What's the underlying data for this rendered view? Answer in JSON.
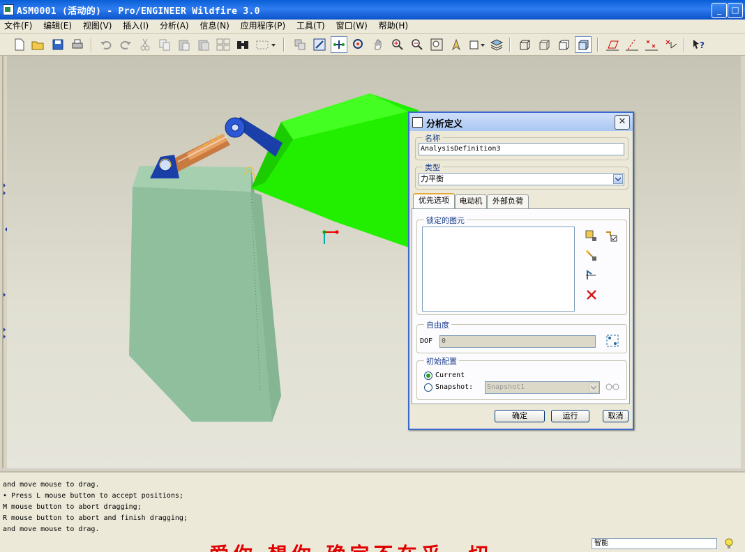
{
  "window": {
    "title": "ASM0001 (活动的) - Pro/ENGINEER Wildfire 3.0",
    "min_label": "_",
    "max_label": "□"
  },
  "menu": [
    "文件(F)",
    "编辑(E)",
    "视图(V)",
    "插入(I)",
    "分析(A)",
    "信息(N)",
    "应用程序(P)",
    "工具(T)",
    "窗口(W)",
    "帮助(H)"
  ],
  "toolbar_icons": [
    "new-icon",
    "open-icon",
    "save-icon",
    "print-icon",
    "undo-icon",
    "redo-icon",
    "cut-icon",
    "copy-icon",
    "paste-icon",
    "paste-special-icon",
    "regenerate-icon",
    "find-icon",
    "select-box-icon",
    "model-tree-icon",
    "sketch-icon",
    "drag-component-icon",
    "connection-icon",
    "pan-icon",
    "zoom-in-icon",
    "zoom-out-icon",
    "refit-icon",
    "orient-icon",
    "saved-views-icon",
    "layers-icon",
    "wireframe-icon",
    "hidden-line-icon",
    "no-hidden-icon",
    "shading-icon",
    "datum-planes-icon",
    "datum-axes-icon",
    "datum-points-icon",
    "coord-sys-icon",
    "help-icon"
  ],
  "dialog": {
    "title": "分析定义",
    "close": "✕",
    "name_label": "名称",
    "name_value": "AnalysisDefinition3",
    "type_label": "类型",
    "type_value": "力平衡",
    "tabs": [
      "优先选项",
      "电动机",
      "外部负荷"
    ],
    "locked_label": "锁定的图元",
    "dof_group_label": "自由度",
    "dof_label": "DOF",
    "dof_value": "0",
    "init_label": "初始配置",
    "radio_current": "Current",
    "radio_snapshot": "Snapshot:",
    "snapshot_value": "Snapshot1",
    "ok": "确定",
    "run": "运行",
    "cancel": "取消"
  },
  "messages": [
    "and move mouse to drag.",
    "• Press L mouse button to accept positions;",
    "M mouse button to abort dragging;",
    "R mouse button to abort and finish dragging;",
    "and move mouse to drag."
  ],
  "slogan": "爱你 想你 确定不在乎一切",
  "status_field": "智能",
  "colors": {
    "title_blue": "#0a5fd6",
    "bucket_green": "#22ee00",
    "body_green": "#8fbf9c"
  }
}
